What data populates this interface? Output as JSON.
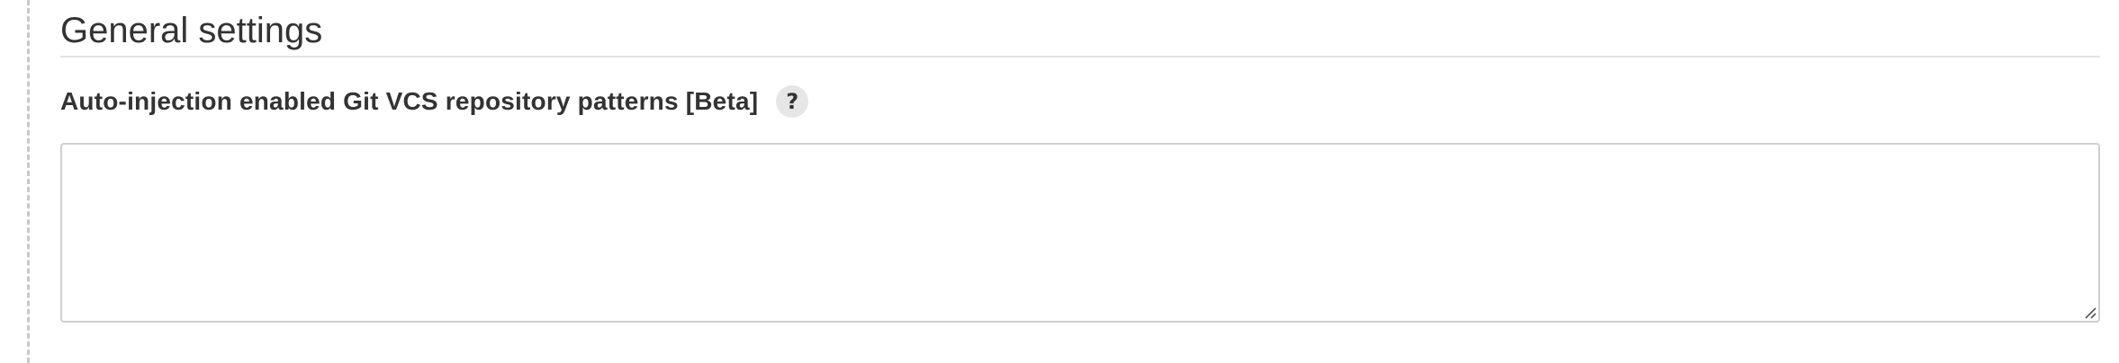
{
  "section": {
    "title": "General settings"
  },
  "field": {
    "label": "Auto-injection enabled Git VCS repository patterns [Beta]",
    "help_glyph": "?",
    "value": "",
    "placeholder": ""
  },
  "icons": {
    "help": "help-icon",
    "resize": "resize-handle-icon"
  },
  "colors": {
    "text": "#333333",
    "divider": "#e3e3e3",
    "help_bg": "#e6e6e6",
    "input_border": "#cfcfcf",
    "section_border": "#c9c9c9"
  }
}
